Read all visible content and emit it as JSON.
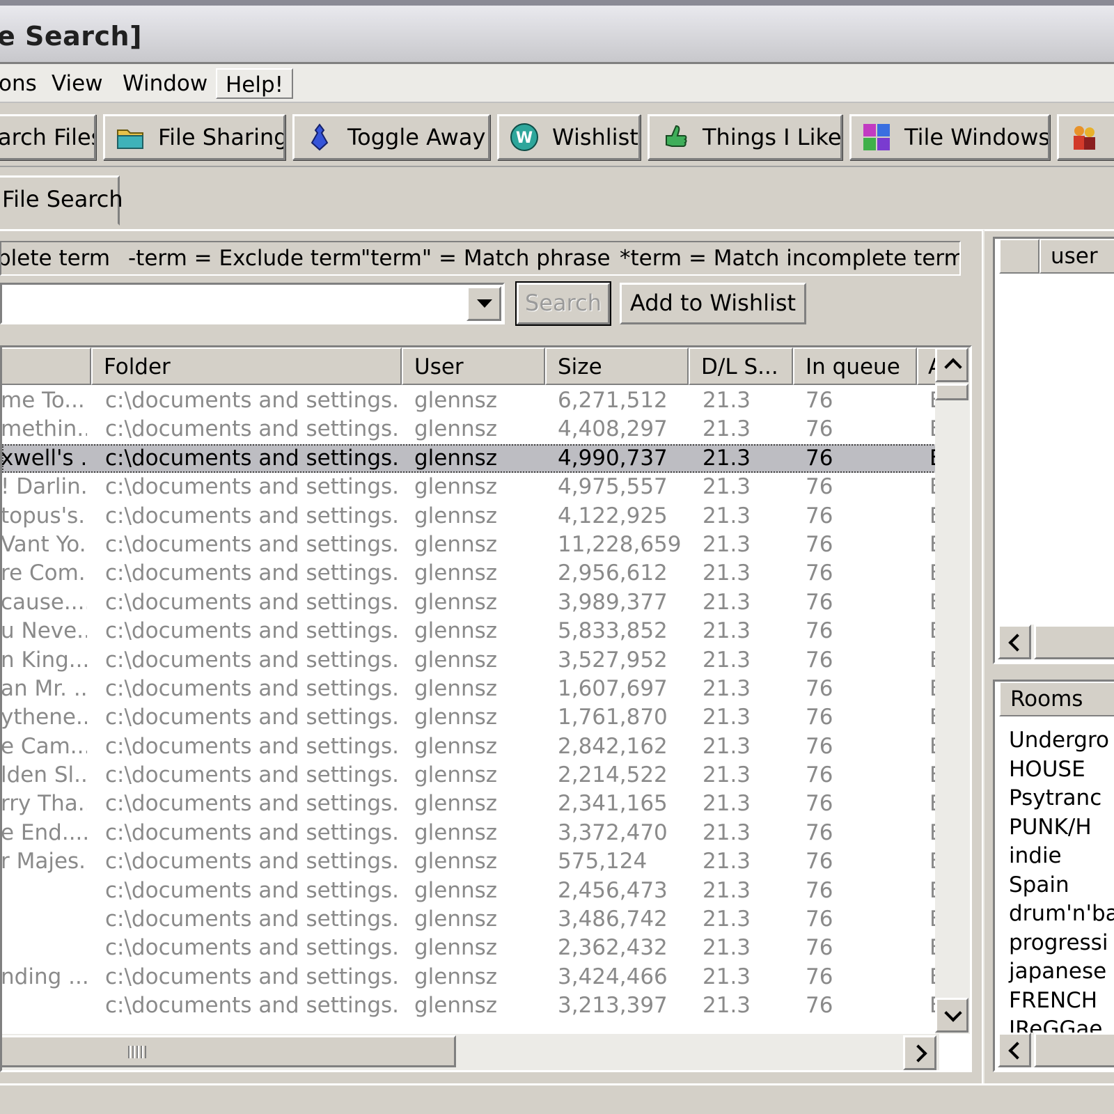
{
  "window": {
    "title": "e Search]"
  },
  "menu": [
    {
      "label": "ons"
    },
    {
      "label": "View"
    },
    {
      "label": "Window"
    },
    {
      "label": "Help!"
    }
  ],
  "toolbar": [
    {
      "label": "arch Files",
      "icon": "search-files-icon"
    },
    {
      "label": "File Sharing",
      "icon": "folder-icon"
    },
    {
      "label": "Toggle Away",
      "icon": "away-icon"
    },
    {
      "label": "Wishlist",
      "icon": "wishlist-icon"
    },
    {
      "label": "Things I Like",
      "icon": "thumbs-up-icon"
    },
    {
      "label": "Tile Windows",
      "icon": "tile-windows-icon"
    },
    {
      "label": "",
      "icon": "users-icon"
    }
  ],
  "tab": {
    "label": "File Search"
  },
  "hints": [
    "plete term",
    "-term = Exclude term",
    "\"term\" = Match phrase",
    "*term = Match incomplete term"
  ],
  "search": {
    "value": "",
    "search_label": "Search",
    "wishlist_label": "Add to Wishlist"
  },
  "results": {
    "columns": [
      "",
      "Folder",
      "User",
      "Size",
      "D/L S...",
      "In queue",
      "A"
    ],
    "rows": [
      {
        "file": "me To...",
        "folder": "c:\\documents and settings...",
        "user": "glennsz",
        "size": "6,271,512",
        "speed": "21.3",
        "queue": "76",
        "extra": "E"
      },
      {
        "file": "methin...",
        "folder": "c:\\documents and settings...",
        "user": "glennsz",
        "size": "4,408,297",
        "speed": "21.3",
        "queue": "76",
        "extra": "E"
      },
      {
        "file": "xwell's ...",
        "folder": "c:\\documents and settings...",
        "user": "glennsz",
        "size": "4,990,737",
        "speed": "21.3",
        "queue": "76",
        "extra": "E"
      },
      {
        "file": "! Darlin...",
        "folder": "c:\\documents and settings...",
        "user": "glennsz",
        "size": "4,975,557",
        "speed": "21.3",
        "queue": "76",
        "extra": "E"
      },
      {
        "file": "topus's...",
        "folder": "c:\\documents and settings...",
        "user": "glennsz",
        "size": "4,122,925",
        "speed": "21.3",
        "queue": "76",
        "extra": "E"
      },
      {
        "file": "Vant Yo...",
        "folder": "c:\\documents and settings...",
        "user": "glennsz",
        "size": "11,228,659",
        "speed": "21.3",
        "queue": "76",
        "extra": "E"
      },
      {
        "file": "re Com...",
        "folder": "c:\\documents and settings...",
        "user": "glennsz",
        "size": "2,956,612",
        "speed": "21.3",
        "queue": "76",
        "extra": "E"
      },
      {
        "file": "cause....",
        "folder": "c:\\documents and settings...",
        "user": "glennsz",
        "size": "3,989,377",
        "speed": "21.3",
        "queue": "76",
        "extra": "E"
      },
      {
        "file": "u Neve...",
        "folder": "c:\\documents and settings...",
        "user": "glennsz",
        "size": "5,833,852",
        "speed": "21.3",
        "queue": "76",
        "extra": "E"
      },
      {
        "file": "n King....",
        "folder": "c:\\documents and settings...",
        "user": "glennsz",
        "size": "3,527,952",
        "speed": "21.3",
        "queue": "76",
        "extra": "E"
      },
      {
        "file": "an Mr. ...",
        "folder": "c:\\documents and settings...",
        "user": "glennsz",
        "size": "1,607,697",
        "speed": "21.3",
        "queue": "76",
        "extra": "E"
      },
      {
        "file": "ythene...",
        "folder": "c:\\documents and settings...",
        "user": "glennsz",
        "size": "1,761,870",
        "speed": "21.3",
        "queue": "76",
        "extra": "E"
      },
      {
        "file": "e Cam...",
        "folder": "c:\\documents and settings...",
        "user": "glennsz",
        "size": "2,842,162",
        "speed": "21.3",
        "queue": "76",
        "extra": "E"
      },
      {
        "file": "lden Sl...",
        "folder": "c:\\documents and settings...",
        "user": "glennsz",
        "size": "2,214,522",
        "speed": "21.3",
        "queue": "76",
        "extra": "E"
      },
      {
        "file": "rry Tha...",
        "folder": "c:\\documents and settings...",
        "user": "glennsz",
        "size": "2,341,165",
        "speed": "21.3",
        "queue": "76",
        "extra": "E"
      },
      {
        "file": "e End....",
        "folder": "c:\\documents and settings...",
        "user": "glennsz",
        "size": "3,372,470",
        "speed": "21.3",
        "queue": "76",
        "extra": "E"
      },
      {
        "file": "r Majes...",
        "folder": "c:\\documents and settings...",
        "user": "glennsz",
        "size": "575,124",
        "speed": "21.3",
        "queue": "76",
        "extra": "E"
      },
      {
        "file": "",
        "folder": "c:\\documents and settings...",
        "user": "glennsz",
        "size": "2,456,473",
        "speed": "21.3",
        "queue": "76",
        "extra": "E"
      },
      {
        "file": "",
        "folder": "c:\\documents and settings...",
        "user": "glennsz",
        "size": "3,486,742",
        "speed": "21.3",
        "queue": "76",
        "extra": "E"
      },
      {
        "file": "",
        "folder": "c:\\documents and settings...",
        "user": "glennsz",
        "size": "2,362,432",
        "speed": "21.3",
        "queue": "76",
        "extra": "E"
      },
      {
        "file": "nding ...",
        "folder": "c:\\documents and settings...",
        "user": "glennsz",
        "size": "3,424,466",
        "speed": "21.3",
        "queue": "76",
        "extra": "E"
      },
      {
        "file": "",
        "folder": "c:\\documents and settings...",
        "user": "glennsz",
        "size": "3,213,397",
        "speed": "21.3",
        "queue": "76",
        "extra": "E"
      }
    ],
    "selected_index": 2
  },
  "user_panel": {
    "columns": [
      "",
      "user"
    ]
  },
  "rooms_panel": {
    "header": "Rooms",
    "items": [
      "Undergro",
      "HOUSE",
      "Psytranc",
      "PUNK/H",
      "indie",
      "Spain",
      "drum'n'ba",
      "progressi",
      "japanese",
      "FRENCH",
      "IReGGae"
    ]
  },
  "colors": {
    "selection": "#bdbdc2",
    "face": "#d4d0c8",
    "dim_text": "#8a8a8a"
  }
}
